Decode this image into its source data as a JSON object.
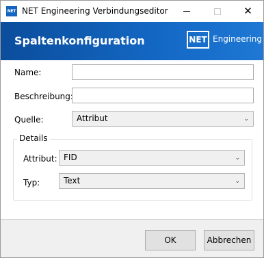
{
  "window": {
    "icon_text": "NET",
    "title": "NET Engineering Verbindungseditor",
    "minimize": "—",
    "maximize": "☐",
    "close": "✕"
  },
  "banner": {
    "title": "Spaltenkonfiguration",
    "logo_box": "NET",
    "logo_text": "Engineering"
  },
  "form": {
    "name_label": "Name:",
    "name_value": "",
    "description_label": "Beschreibung:",
    "description_value": "",
    "source_label": "Quelle:",
    "source_value": "Attribut"
  },
  "details": {
    "legend": "Details",
    "attribute_label": "Attribut:",
    "attribute_value": "FID",
    "type_label": "Typ:",
    "type_value": "Text"
  },
  "buttons": {
    "ok": "OK",
    "cancel": "Abbrechen"
  },
  "icons": {
    "app": "net-app-icon",
    "dropdown": "chevron-down-icon"
  },
  "colors": {
    "banner": "#1368c4",
    "button": "#e1e1e1"
  }
}
